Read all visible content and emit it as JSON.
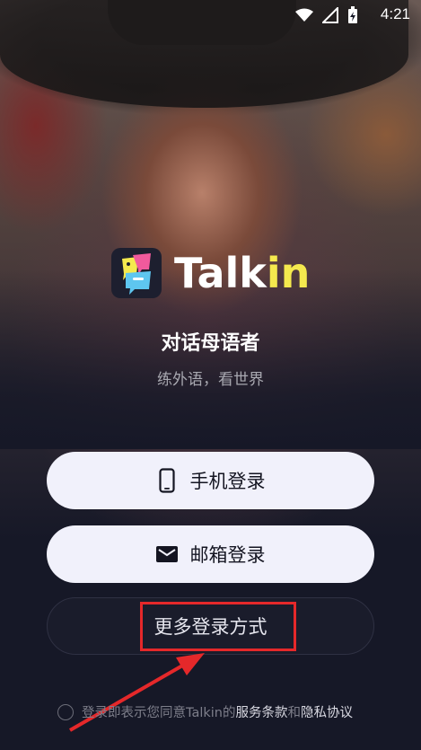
{
  "status_bar": {
    "time": "4:21",
    "icons": [
      "wifi-icon",
      "signal-icon",
      "battery-charging-icon"
    ]
  },
  "brand": {
    "name_part1": "Talk",
    "name_part2": "in",
    "tagline": "对话母语者",
    "subtitle": "练外语，看世界",
    "colors": {
      "accent_yellow": "#f4e94e",
      "logo_pink": "#f05a9c",
      "logo_yellow": "#f4e94e",
      "logo_blue": "#5ec6f0"
    }
  },
  "buttons": {
    "phone_login": "手机登录",
    "email_login": "邮箱登录",
    "more_login": "更多登录方式"
  },
  "agreement": {
    "prefix": "登录即表示您同意Talkin的",
    "terms": "服务条款",
    "and": "和",
    "privacy": "隐私协议"
  },
  "annotation": {
    "highlight_color": "#e5282a"
  }
}
